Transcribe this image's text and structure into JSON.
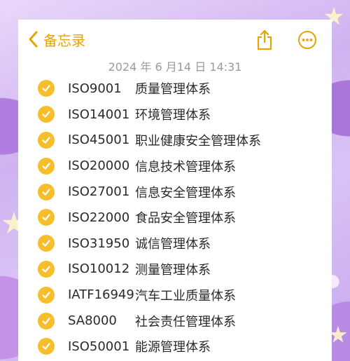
{
  "nav": {
    "back_label": "备忘录",
    "share_icon": "share-icon",
    "more_icon": "more-icon"
  },
  "note": {
    "date": "2024 年 6 月14 日 14:31",
    "items": [
      {
        "code": "ISO9001",
        "name": "质量管理体系",
        "checked": true
      },
      {
        "code": "ISO14001",
        "name": "环境管理体系",
        "checked": true
      },
      {
        "code": "ISO45001",
        "name": "职业健康安全管理体系",
        "checked": true
      },
      {
        "code": "ISO20000",
        "name": "信息技术管理体系",
        "checked": true
      },
      {
        "code": "ISO27001",
        "name": "信息安全管理体系",
        "checked": true
      },
      {
        "code": "ISO22000",
        "name": "食品安全管理体系",
        "checked": true
      },
      {
        "code": "ISO31950",
        "name": "诚信管理体系",
        "checked": true
      },
      {
        "code": "ISO10012",
        "name": "测量管理体系",
        "checked": true
      },
      {
        "code": "IATF16949",
        "name": "汽车工业质量体系",
        "checked": true
      },
      {
        "code": "SA8000",
        "name": "社会责任管理体系",
        "checked": true
      },
      {
        "code": "ISO50001",
        "name": "能源管理体系",
        "checked": true
      }
    ]
  },
  "colors": {
    "accent": "#e5a400",
    "check": "#f6be2a",
    "date_text": "#9a9a9a"
  }
}
